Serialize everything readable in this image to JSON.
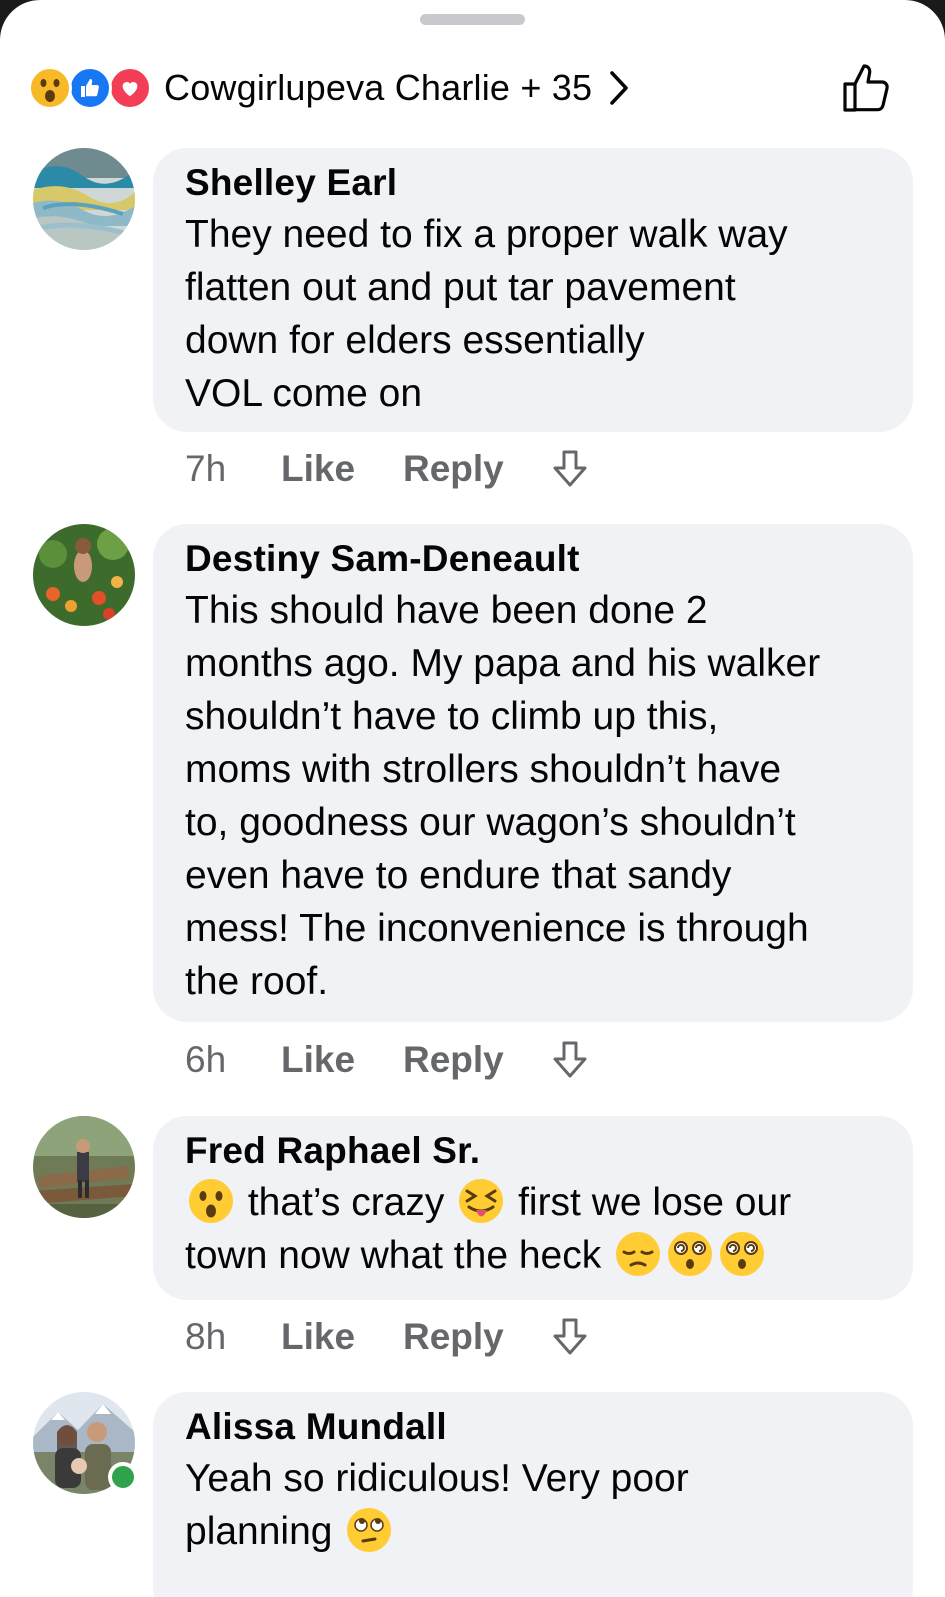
{
  "header": {
    "reaction_icons": [
      "wow-reaction-icon",
      "like-reaction-icon",
      "love-reaction-icon"
    ],
    "reaction_names": "Cowgirlupeva Charlie + 35",
    "colors": {
      "like_blue": "#1877f2",
      "love_red": "#f33e58",
      "wow_yellow": "#f7b928"
    }
  },
  "comments": [
    {
      "author": "Shelley Earl",
      "text": "They  need to  fix a proper walk way\nflatten out and put tar pavement\ndown for elders essentially\nVOL come on",
      "time": "7h",
      "like": "Like",
      "reply": "Reply"
    },
    {
      "author": "Destiny Sam-Deneault",
      "text": "This should have been done 2\nmonths ago. My papa and his walker\nshouldn’t have to climb up this,\nmoms with strollers shouldn’t have\nto, goodness our wagon’s shouldn’t\neven have to endure that sandy\nmess! The inconvenience is through\nthe roof.",
      "time": "6h",
      "like": "Like",
      "reply": "Reply"
    },
    {
      "author": "Fred Raphael Sr.",
      "text_parts": [
        "that’s crazy",
        "first we lose our",
        "town now what the heck"
      ],
      "time": "8h",
      "like": "Like",
      "reply": "Reply"
    },
    {
      "author": "Alissa Mundall",
      "text": "Yeah so ridiculous! Very poor",
      "text_line2": "planning",
      "online": true
    }
  ]
}
